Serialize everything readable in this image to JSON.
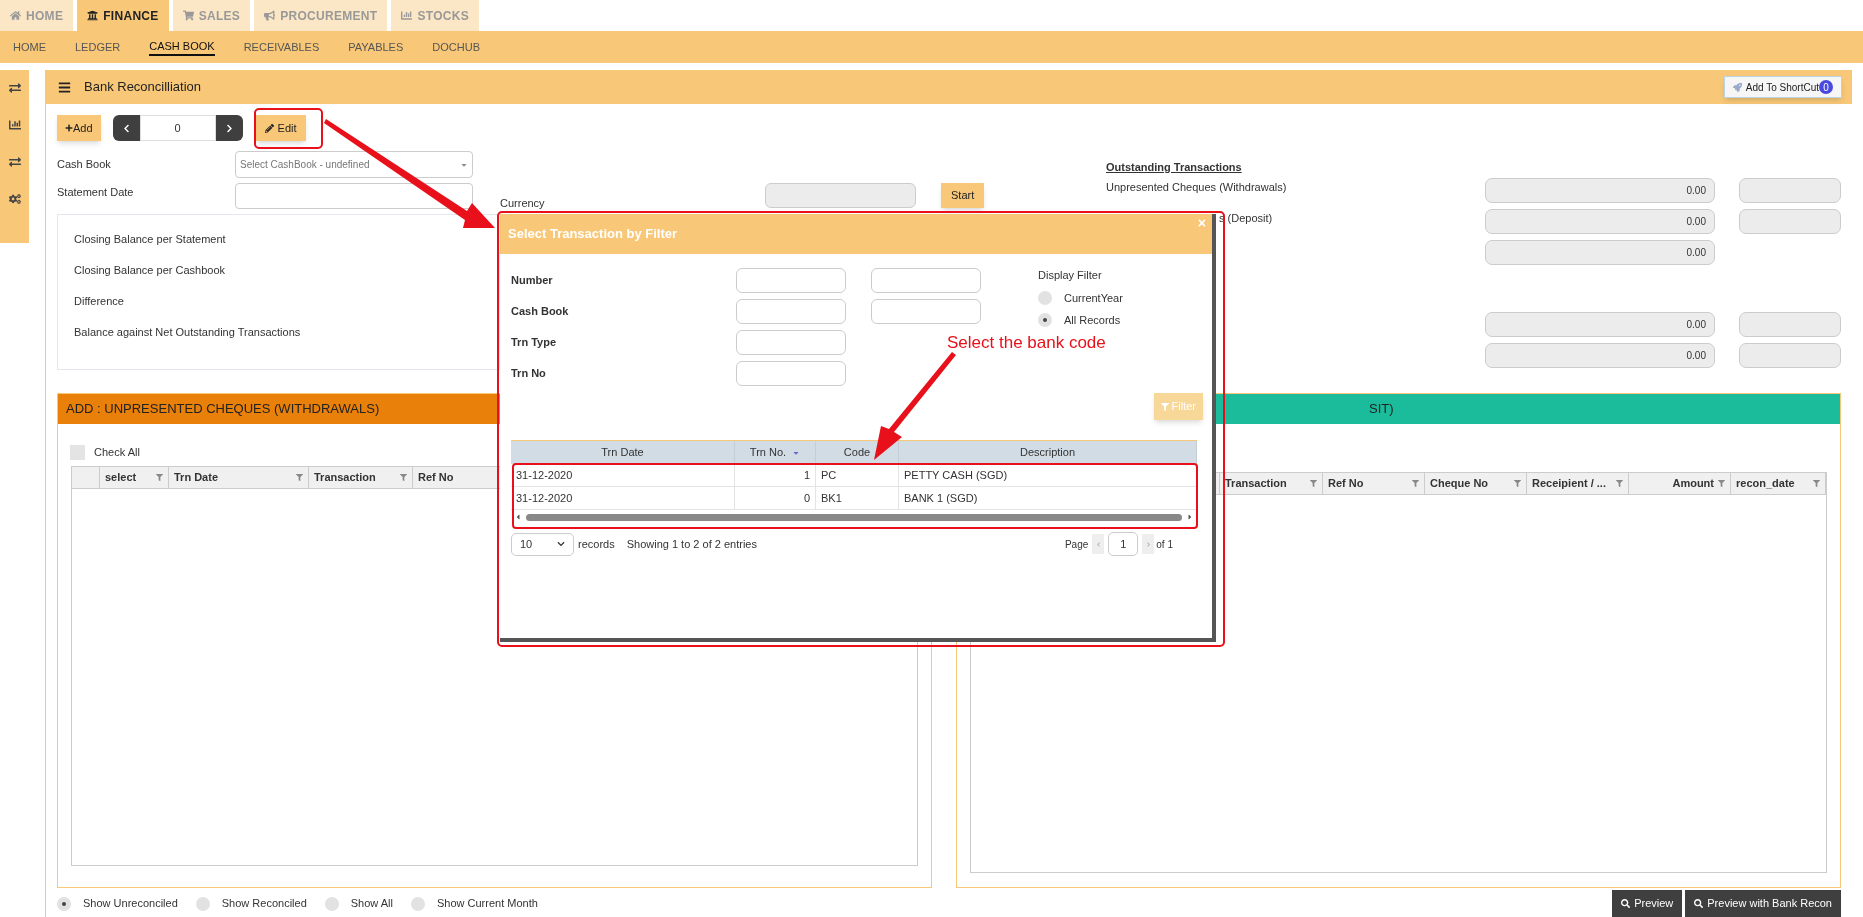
{
  "top_tabs": [
    {
      "label": "HOME",
      "selected": false
    },
    {
      "label": "FINANCE",
      "selected": true
    },
    {
      "label": "SALES",
      "selected": false
    },
    {
      "label": "PROCUREMENT",
      "selected": false
    },
    {
      "label": "STOCKS",
      "selected": false
    }
  ],
  "sub_nav": [
    {
      "label": "HOME",
      "selected": false
    },
    {
      "label": "LEDGER",
      "selected": false
    },
    {
      "label": "CASH BOOK",
      "selected": true
    },
    {
      "label": "RECEIVABLES",
      "selected": false
    },
    {
      "label": "PAYABLES",
      "selected": false
    },
    {
      "label": "DOCHUB",
      "selected": false
    }
  ],
  "page": {
    "title": "Bank Reconcilliation",
    "shortcut_button": "Add To ShortCut",
    "shortcut_count": "0"
  },
  "toolbar": {
    "add": "Add",
    "record_number": "0",
    "edit": "Edit"
  },
  "form": {
    "cash_book_label": "Cash Book",
    "cash_book_placeholder": "Select CashBook - undefined",
    "statement_date_label": "Statement Date",
    "currency_label": "Currency",
    "start_button": "Start"
  },
  "balances": [
    "Closing Balance per Statement",
    "Closing Balance per Cashbook",
    "Difference",
    "Balance against Net Outstanding Transactions"
  ],
  "outstanding": {
    "title": "Outstanding Transactions",
    "rows": [
      {
        "label": "Unpresented Cheques (Withdrawals)",
        "value": "0.00",
        "extra_field": true
      },
      {
        "label": "s (Deposit)",
        "value": "0.00",
        "extra_field": true
      },
      {
        "value": "0.00",
        "extra_field": false
      },
      {
        "value": "0.00",
        "extra_field": true
      },
      {
        "value": "0.00",
        "extra_field": true
      }
    ]
  },
  "withdrawals": {
    "header": "ADD : UNPRESENTED CHEQUES (WITHDRAWALS)",
    "check_all": {
      "label": "Check All",
      "checked": false
    },
    "columns": [
      "select",
      "Trn Date",
      "Transaction",
      "Ref No"
    ]
  },
  "deposits": {
    "header": "SIT)",
    "columns": [
      "Transaction",
      "Ref No",
      "Cheque No",
      "Receipient / ...",
      "Amount",
      "recon_date"
    ]
  },
  "show_filters": [
    {
      "label": "Show Unreconciled",
      "selected": true
    },
    {
      "label": "Show Reconciled",
      "selected": false
    },
    {
      "label": "Show All",
      "selected": false
    },
    {
      "label": "Show Current Month",
      "selected": false
    }
  ],
  "buttons": [
    "Preview",
    "Preview with Bank Recon"
  ],
  "modal": {
    "title": "Select Transaction by Filter",
    "close": "×",
    "fields": [
      {
        "label": "Number",
        "kind": "range"
      },
      {
        "label": "Cash Book",
        "kind": "range"
      },
      {
        "label": "Trn Type",
        "kind": "single"
      },
      {
        "label": "Trn No",
        "kind": "single"
      }
    ],
    "display_filter": {
      "title": "Display Filter",
      "options": [
        {
          "label": "CurrentYear",
          "selected": false
        },
        {
          "label": "All Records",
          "selected": true
        }
      ]
    },
    "filter_button": "Filter",
    "columns": [
      {
        "label": "Trn Date",
        "sorted": false
      },
      {
        "label": "Trn No.",
        "sorted": true
      },
      {
        "label": "Code",
        "sorted": false
      },
      {
        "label": "Description",
        "sorted": false
      }
    ],
    "rows": [
      [
        "31-12-2020",
        "1",
        "PC",
        "PETTY CASH (SGD)"
      ],
      [
        "31-12-2020",
        "0",
        "BK1",
        "BANK 1 (SGD)"
      ]
    ],
    "page_size": "10",
    "records_label": "records",
    "info": "Showing 1 to 2 of 2 entries",
    "page_label": "Page",
    "page": "1",
    "page_total": "of 1"
  },
  "annotation": "Select the bank code"
}
